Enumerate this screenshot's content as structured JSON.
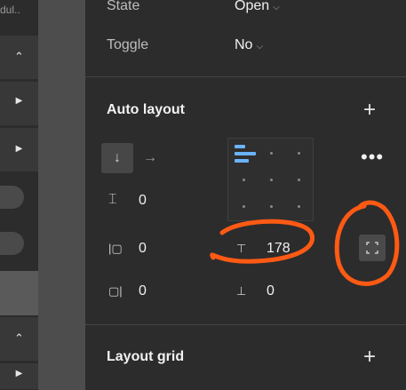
{
  "layer_panel": {
    "truncated_text": "dul.."
  },
  "properties": {
    "state": {
      "label": "State",
      "value": "Open"
    },
    "toggle": {
      "label": "Toggle",
      "value": "No"
    }
  },
  "auto_layout": {
    "title": "Auto layout",
    "spacing_between": "0",
    "padding_left": "0",
    "padding_top": "178",
    "padding_right": "0",
    "padding_bottom": "0"
  },
  "layout_grid": {
    "title": "Layout grid"
  },
  "colors": {
    "accent_blue": "#6ab3ff",
    "annotation_orange": "#ff5a14"
  }
}
